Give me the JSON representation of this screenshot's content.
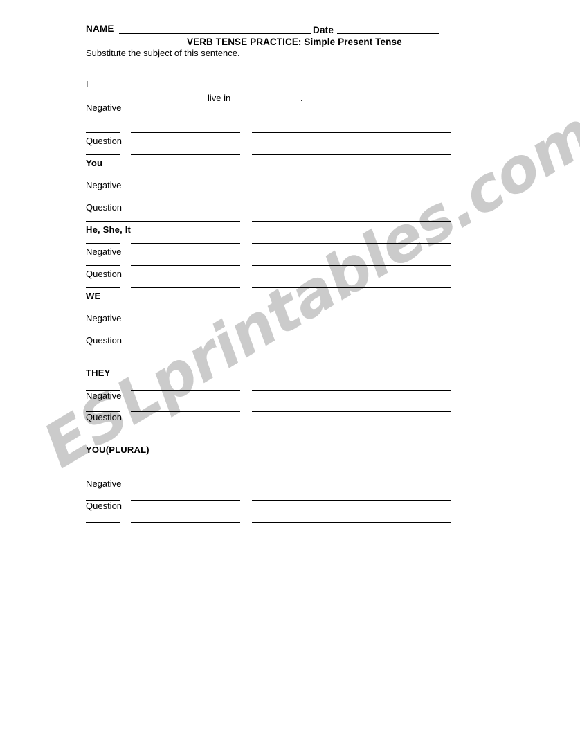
{
  "document": {
    "type": "worksheet",
    "title": "VERB TENSE PRACTICE: Simple Present Tense",
    "instruction": "Substitute the subject of this sentence."
  },
  "header": {
    "name_label": "NAME",
    "date_label": "Date"
  },
  "example": {
    "pronoun": "I",
    "verb_phrase": "live in",
    "period": "."
  },
  "row_labels": {
    "negative": "Negative",
    "question": "Question"
  },
  "blocks": [
    {
      "pronoun": "I",
      "negative": "Negative",
      "question": "Question"
    },
    {
      "pronoun": "You",
      "negative": "Negative",
      "question": "Question"
    },
    {
      "pronoun": "He, She, It",
      "negative": "Negative",
      "question": "Question"
    },
    {
      "pronoun": "WE",
      "negative": "Negative",
      "question": "Question"
    },
    {
      "pronoun": "THEY",
      "negative": "Negative",
      "question": "Question"
    },
    {
      "pronoun": "YOU(PLURAL)",
      "negative": "Negative",
      "question": "Question"
    }
  ],
  "watermark": {
    "text": "ESLprintables.com",
    "color": "#cbcbcb"
  },
  "colors": {
    "page_background": "#ffffff",
    "ink": "#000000",
    "rule": "#000000"
  }
}
